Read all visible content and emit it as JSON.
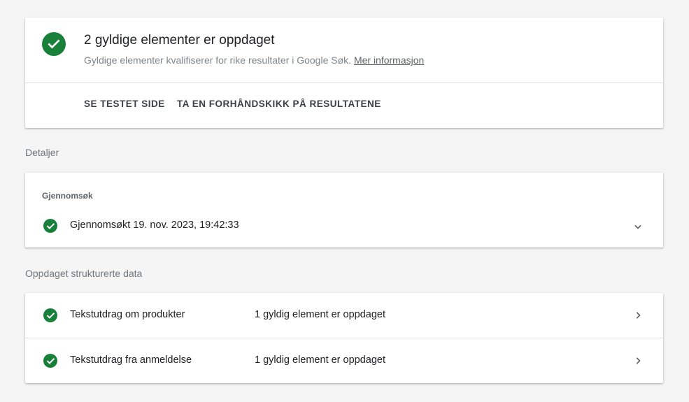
{
  "summary": {
    "title": "2 gyldige elementer er oppdaget",
    "subtitle": "Gyldige elementer kvalifiserer for rike resultater i Google Søk.",
    "link_label": "Mer informasjon",
    "actions": {
      "view_tested_page": "SE TESTET SIDE",
      "preview_results": "TA EN FORHÅNDSKIKK PÅ RESULTATENE"
    },
    "icon": "check-circle-icon"
  },
  "details": {
    "section_label": "Detaljer",
    "crawl": {
      "heading": "Gjennomsøk",
      "status_text": "Gjennomsøkt 19. nov. 2023, 19:42:33",
      "icon": "check-circle-icon",
      "expand_icon": "chevron-down-icon"
    }
  },
  "structured_data": {
    "section_label": "Oppdaget strukturerte data",
    "items": [
      {
        "name": "Tekstutdrag om produkter",
        "status": "1 gyldig element er oppdaget"
      },
      {
        "name": "Tekstutdrag fra anmeldelse",
        "status": "1 gyldig element er oppdaget"
      }
    ]
  },
  "colors": {
    "success_green": "#188038",
    "background": "#f5f5f5",
    "card": "#ffffff"
  }
}
